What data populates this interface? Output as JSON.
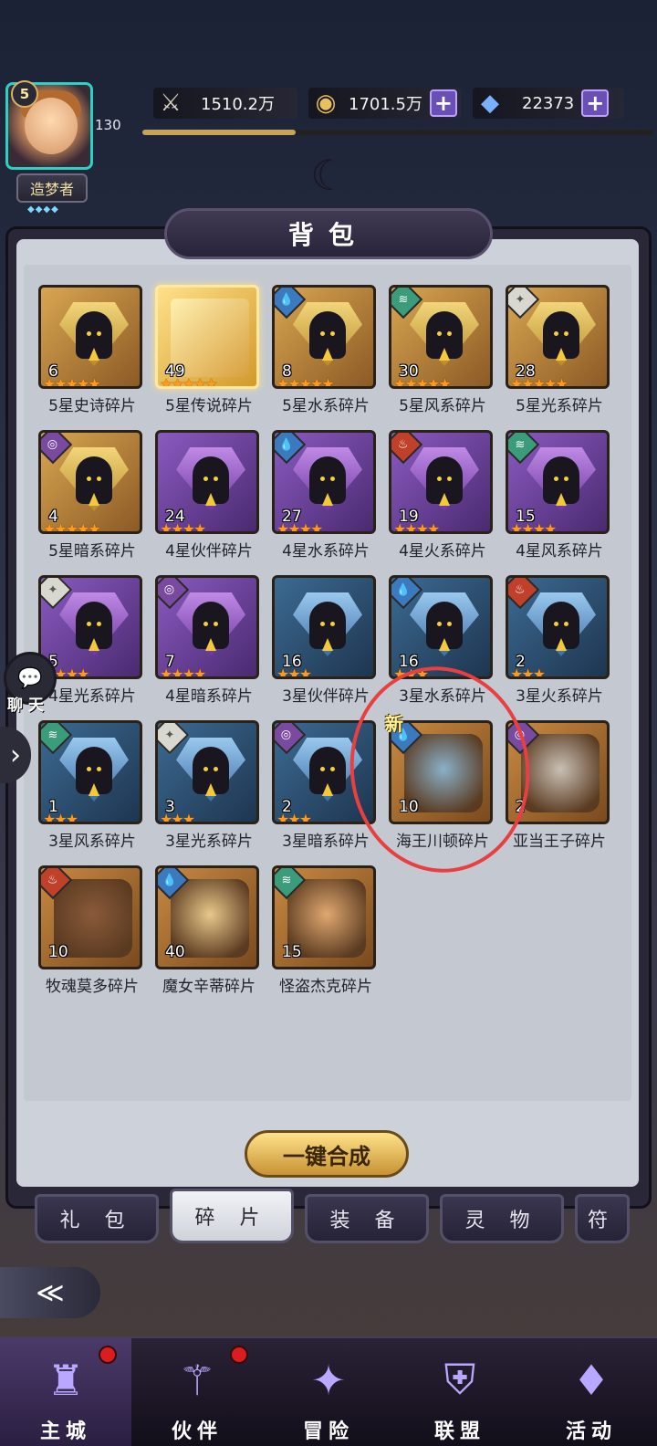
{
  "player": {
    "level": "5",
    "exp": "130",
    "exp_progress": 0.3,
    "title": "造梦者",
    "title_dots": "◆◆◆◆"
  },
  "resources": [
    {
      "icon": "sword-icon",
      "value": "1510.2万",
      "has_plus": false
    },
    {
      "icon": "gold-coin-icon",
      "value": "1701.5万",
      "has_plus": true
    },
    {
      "icon": "diamond-icon",
      "value": "22373",
      "has_plus": true
    }
  ],
  "panel": {
    "title": "背包"
  },
  "items": [
    {
      "count": "6",
      "stars": 5,
      "label": "5星史诗碎片",
      "frame": "gold",
      "element": null
    },
    {
      "count": "49",
      "stars": 5,
      "label": "5星传说碎片",
      "frame": "legend",
      "element": null
    },
    {
      "count": "8",
      "stars": 5,
      "label": "5星水系碎片",
      "frame": "gold",
      "element": "water"
    },
    {
      "count": "30",
      "stars": 5,
      "label": "5星风系碎片",
      "frame": "gold",
      "element": "wind"
    },
    {
      "count": "28",
      "stars": 5,
      "label": "5星光系碎片",
      "frame": "gold",
      "element": "light"
    },
    {
      "count": "4",
      "stars": 5,
      "label": "5星暗系碎片",
      "frame": "gold",
      "element": "dark"
    },
    {
      "count": "24",
      "stars": 4,
      "label": "4星伙伴碎片",
      "frame": "purple",
      "element": null
    },
    {
      "count": "27",
      "stars": 4,
      "label": "4星水系碎片",
      "frame": "purple",
      "element": "water"
    },
    {
      "count": "19",
      "stars": 4,
      "label": "4星火系碎片",
      "frame": "purple",
      "element": "fire"
    },
    {
      "count": "15",
      "stars": 4,
      "label": "4星风系碎片",
      "frame": "purple",
      "element": "wind"
    },
    {
      "count": "5",
      "stars": 4,
      "label": "4星光系碎片",
      "frame": "purple",
      "element": "light"
    },
    {
      "count": "7",
      "stars": 4,
      "label": "4星暗系碎片",
      "frame": "purple",
      "element": "dark"
    },
    {
      "count": "16",
      "stars": 3,
      "label": "3星伙伴碎片",
      "frame": "blue",
      "element": null
    },
    {
      "count": "16",
      "stars": 3,
      "label": "3星水系碎片",
      "frame": "blue",
      "element": "water"
    },
    {
      "count": "2",
      "stars": 3,
      "label": "3星火系碎片",
      "frame": "blue",
      "element": "fire"
    },
    {
      "count": "1",
      "stars": 3,
      "label": "3星风系碎片",
      "frame": "blue",
      "element": "wind"
    },
    {
      "count": "3",
      "stars": 3,
      "label": "3星光系碎片",
      "frame": "blue",
      "element": "light"
    },
    {
      "count": "2",
      "stars": 3,
      "label": "3星暗系碎片",
      "frame": "blue",
      "element": "dark"
    },
    {
      "count": "10",
      "stars": 0,
      "label": "海王川顿碎片",
      "frame": "hero",
      "element": "water",
      "new": "新",
      "hero_color": "#8ab0c8"
    },
    {
      "count": "2",
      "stars": 0,
      "label": "亚当王子碎片",
      "frame": "hero",
      "element": "dark",
      "hero_color": "#c8c0b4"
    },
    {
      "count": "10",
      "stars": 0,
      "label": "牧魂莫多碎片",
      "frame": "hero",
      "element": "fire",
      "hero_color": "#8a5a3a"
    },
    {
      "count": "40",
      "stars": 0,
      "label": "魔女辛蒂碎片",
      "frame": "hero",
      "element": "water",
      "hero_color": "#e8c88a"
    },
    {
      "count": "15",
      "stars": 0,
      "label": "怪盗杰克碎片",
      "frame": "hero",
      "element": "wind",
      "hero_color": "#e0a870"
    }
  ],
  "chat": {
    "label": "聊 天"
  },
  "merge_button": "一键合成",
  "tabs": [
    "礼 包",
    "碎 片",
    "装 备",
    "灵 物",
    "符"
  ],
  "active_tab": 1,
  "nav": [
    {
      "label": "主城",
      "icon": "castle-icon",
      "glyph": "♜",
      "red_dot": true,
      "active": true
    },
    {
      "label": "伙伴",
      "icon": "wizard-hat-icon",
      "glyph": "⚚",
      "red_dot": true,
      "active": false
    },
    {
      "label": "冒险",
      "icon": "compass-icon",
      "glyph": "✦",
      "red_dot": false,
      "active": false
    },
    {
      "label": "联盟",
      "icon": "shield-icon",
      "glyph": "⛨",
      "red_dot": false,
      "active": false
    },
    {
      "label": "活动",
      "icon": "cards-icon",
      "glyph": "♦",
      "red_dot": false,
      "active": false
    }
  ],
  "colors": {
    "accent_gold": "#d8a650",
    "star": "#ff9a1a",
    "annotation_red": "#e84040"
  }
}
